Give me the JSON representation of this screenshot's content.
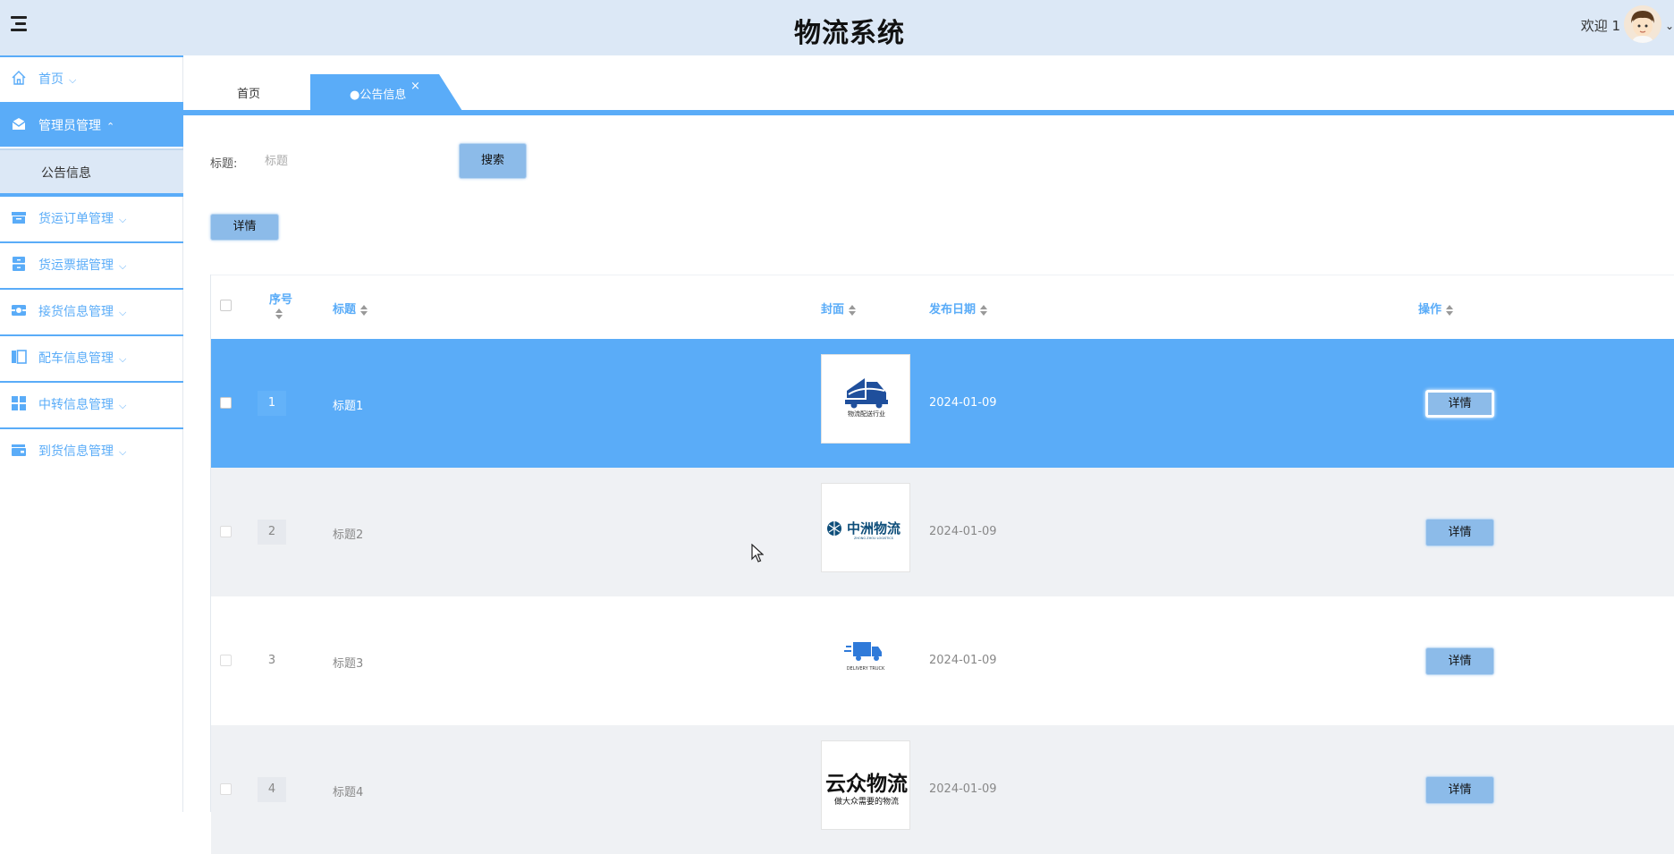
{
  "header": {
    "title": "物流系统",
    "welcome": "欢迎 1"
  },
  "sidebar": {
    "items": [
      {
        "label": "首页",
        "icon": "home-icon",
        "expanded": false
      },
      {
        "label": "管理员管理",
        "icon": "mail-icon",
        "expanded": true,
        "active": true,
        "children": [
          {
            "label": "公告信息"
          }
        ]
      },
      {
        "label": "货运订单管理",
        "icon": "box-icon",
        "expanded": false
      },
      {
        "label": "货运票据管理",
        "icon": "cabinet-icon",
        "expanded": false
      },
      {
        "label": "接货信息管理",
        "icon": "card-icon",
        "expanded": false
      },
      {
        "label": "配车信息管理",
        "icon": "layout-icon",
        "expanded": false
      },
      {
        "label": "中转信息管理",
        "icon": "grid-icon",
        "expanded": false
      },
      {
        "label": "到货信息管理",
        "icon": "wallet-icon",
        "expanded": false
      }
    ]
  },
  "tabs": {
    "home": "首页",
    "active": "●公告信息",
    "close": "×"
  },
  "search": {
    "label": "标题:",
    "placeholder": "标题",
    "button": "搜索"
  },
  "toolbar": {
    "detail": "详情"
  },
  "table": {
    "columns": [
      "序号",
      "标题",
      "封面",
      "发布日期",
      "操作"
    ],
    "rows": [
      {
        "index": "1",
        "title": "标题1",
        "cover": "物流配送行业",
        "date": "2024-01-09",
        "action": "详情",
        "selected": true
      },
      {
        "index": "2",
        "title": "标题2",
        "cover": "中洲物流",
        "cover_sub": "ZHONG ZHOU LOGISTICS",
        "date": "2024-01-09",
        "action": "详情"
      },
      {
        "index": "3",
        "title": "标题3",
        "cover": "DELIVERY TRUCK",
        "date": "2024-01-09",
        "action": "详情"
      },
      {
        "index": "4",
        "title": "标题4",
        "cover": "云众物流",
        "cover_sub": "做大众需要的物流",
        "date": "2024-01-09",
        "action": "详情"
      }
    ]
  },
  "colors": {
    "accent": "#5aacf8",
    "header_bg": "#dce8f6",
    "button_bg": "#8cbbe9"
  }
}
